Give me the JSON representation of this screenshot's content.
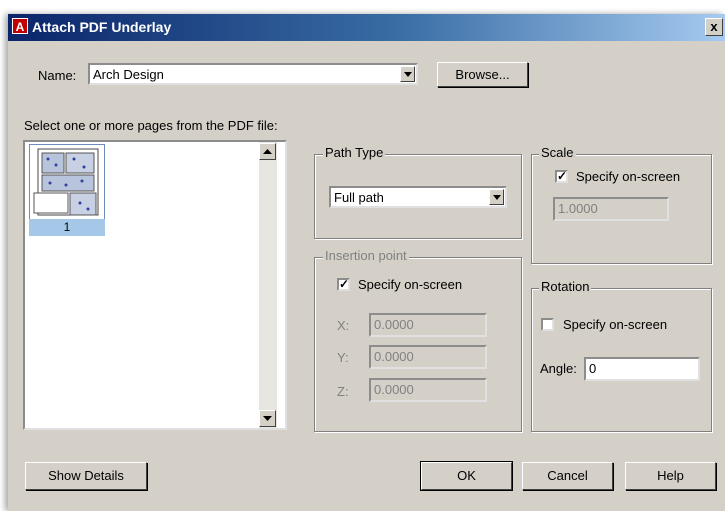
{
  "window": {
    "title": "Attach PDF Underlay",
    "app_icon": "A",
    "close_glyph": "x"
  },
  "name_field": {
    "label": "Name:",
    "value": "Arch Design"
  },
  "browse_button": "Browse...",
  "pages_label": "Select one or more pages from the PDF file:",
  "pages": [
    {
      "label": "1",
      "selected": true
    }
  ],
  "path_type": {
    "title": "Path Type",
    "value": "Full path"
  },
  "scale": {
    "title": "Scale",
    "checkbox_label": "Specify on-screen",
    "checked": true,
    "value": "1.0000"
  },
  "insertion": {
    "title": "Insertion point",
    "checkbox_label": "Specify on-screen",
    "checked": true,
    "x_label": "X:",
    "x_value": "0.0000",
    "y_label": "Y:",
    "y_value": "0.0000",
    "z_label": "Z:",
    "z_value": "0.0000"
  },
  "rotation": {
    "title": "Rotation",
    "checkbox_label": "Specify on-screen",
    "checked": false,
    "angle_label": "Angle:",
    "angle_value": "0"
  },
  "buttons": {
    "show_details": "Show Details",
    "ok": "OK",
    "cancel": "Cancel",
    "help": "Help"
  },
  "check_glyph": "✓"
}
